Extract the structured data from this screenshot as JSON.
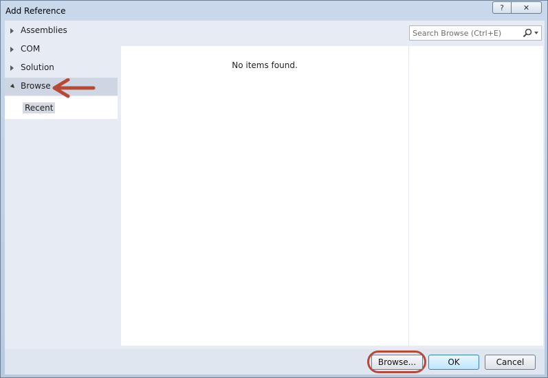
{
  "window": {
    "title": "Add Reference",
    "help_label": "?",
    "close_label": "✕"
  },
  "sidebar": {
    "items": [
      {
        "label": "Assemblies",
        "expanded": false
      },
      {
        "label": "COM",
        "expanded": false
      },
      {
        "label": "Solution",
        "expanded": false
      },
      {
        "label": "Browse",
        "expanded": true,
        "selected": true
      }
    ],
    "subitems": [
      {
        "label": "Recent"
      }
    ]
  },
  "search": {
    "placeholder": "Search Browse (Ctrl+E)",
    "icon": "search-icon"
  },
  "list": {
    "empty_text": "No items found."
  },
  "footer": {
    "browse_label": "Browse...",
    "ok_label": "OK",
    "cancel_label": "Cancel"
  },
  "colors": {
    "annotation": "#b64a37",
    "selected_item": "#cfd6e3",
    "ok_border": "#3c7fb1"
  }
}
